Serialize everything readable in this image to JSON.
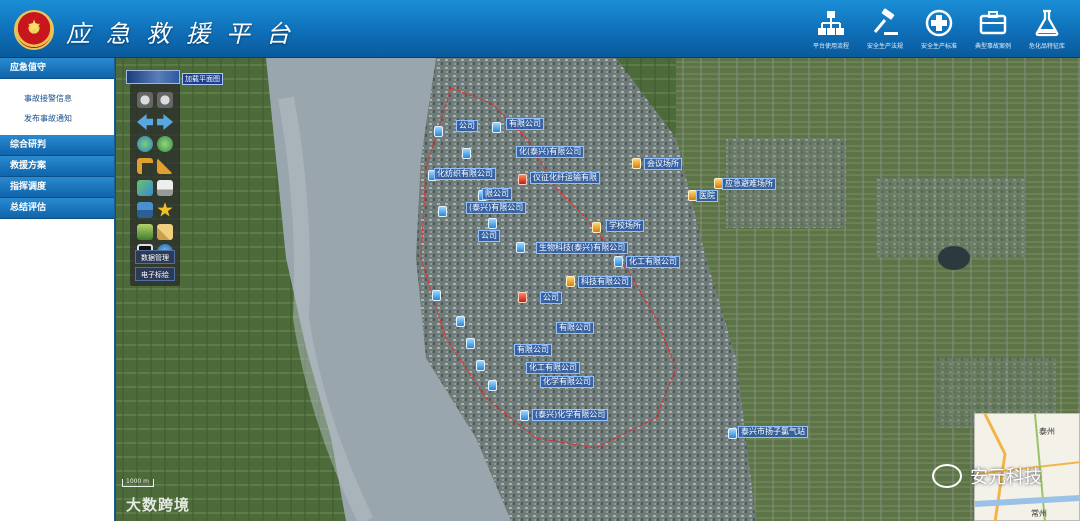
{
  "app": {
    "title": "应急救援平台"
  },
  "top_tools": [
    {
      "label": "平台使用流程",
      "icon": "org-chart-icon"
    },
    {
      "label": "安全生产法规",
      "icon": "gavel-icon"
    },
    {
      "label": "安全生产标准",
      "icon": "medical-cross-icon"
    },
    {
      "label": "典型事故案例",
      "icon": "briefcase-icon"
    },
    {
      "label": "危化品特征库",
      "icon": "flask-icon"
    }
  ],
  "sidebar": {
    "sections": [
      {
        "title": "应急值守",
        "items": [
          "事故接警信息",
          "发布事故通知"
        ]
      },
      {
        "title": "综合研判",
        "items": []
      },
      {
        "title": "救援方案",
        "items": []
      },
      {
        "title": "指挥调度",
        "items": []
      },
      {
        "title": "总结评估",
        "items": []
      }
    ]
  },
  "map": {
    "overview_label": "加载平面图",
    "toolbox_buttons": [
      "数据管理",
      "电子标绘"
    ],
    "scale_text": "1000 m",
    "pois": [
      {
        "label": "公司",
        "kind": "normal"
      },
      {
        "label": "有限公司",
        "kind": "normal"
      },
      {
        "label": "化(泰兴)有限公司",
        "kind": "normal"
      },
      {
        "label": "化纺织有限公司",
        "kind": "normal"
      },
      {
        "label": "仪征化纤运输有限",
        "kind": "fire"
      },
      {
        "label": "限公司",
        "kind": "normal"
      },
      {
        "label": "(泰兴)有限公司",
        "kind": "normal"
      },
      {
        "label": "公司",
        "kind": "normal"
      },
      {
        "label": "学校场所",
        "kind": "warn"
      },
      {
        "label": "生物科技(泰兴)有限公司",
        "kind": "normal"
      },
      {
        "label": "化工有限公司",
        "kind": "normal"
      },
      {
        "label": "科技有限公司",
        "kind": "normal"
      },
      {
        "label": "公司",
        "kind": "normal"
      },
      {
        "label": "有限公司",
        "kind": "normal"
      },
      {
        "label": "有限公司",
        "kind": "normal"
      },
      {
        "label": "化工有限公司",
        "kind": "normal"
      },
      {
        "label": "化学有限公司",
        "kind": "normal"
      },
      {
        "label": "(泰兴)化学有限公司",
        "kind": "normal"
      },
      {
        "label": "会议场所",
        "kind": "warn"
      },
      {
        "label": "医院",
        "kind": "warn"
      },
      {
        "label": "应急避难场所",
        "kind": "warn"
      },
      {
        "label": "泰兴市扬子氯气站",
        "kind": "normal"
      }
    ],
    "minimap": {
      "cities": [
        "泰州",
        "常州"
      ]
    }
  },
  "watermarks": {
    "left": "大数跨境",
    "right": "安元科技"
  }
}
